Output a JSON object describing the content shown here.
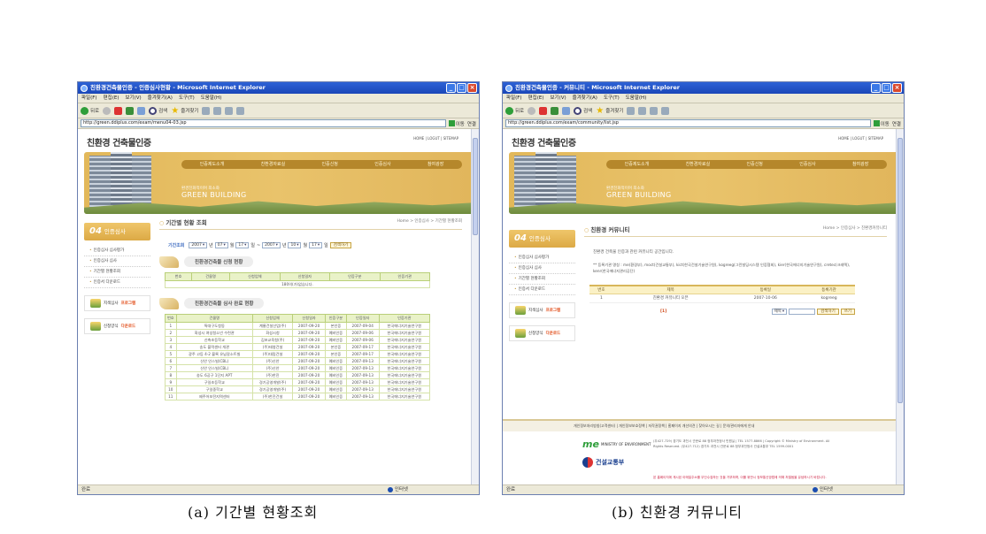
{
  "shotA": {
    "window_title": "친환경건축물인증 - 인증심사현황 - Microsoft Internet Explorer",
    "menus": [
      "파일(F)",
      "편집(E)",
      "보기(V)",
      "즐겨찾기(A)",
      "도구(T)",
      "도움말(H)"
    ],
    "toolbar": {
      "back": "뒤로",
      "search": "검색",
      "favorites": "즐겨찾기"
    },
    "address": "http://green.ddiplus.com/exam/menu04-03.jsp",
    "go_label": "이동",
    "links_label": "연결",
    "site_logo": "친환경 건축물인증",
    "topnav": "HOME | LOGUT | SITEMAP",
    "nav_items": [
      "인증제도소개",
      "친환경자료실",
      "인증신청",
      "인증심사",
      "참여광장"
    ],
    "slogan_small": "환경친화적이며 최소화",
    "slogan_big": "GREEN BUILDING",
    "side_title_num": "04",
    "side_title": "인증심사",
    "side_menu": [
      "인증심사 심사평가",
      "인증심사 심사",
      "기간별 현황조회",
      "인증서 다운로드"
    ],
    "banner1_pre": "지색심사",
    "banner1_red": "프로그램",
    "banner2_pre": "신청양식",
    "banner2_red": "다운로드",
    "page_title": "기간별 현황 조회",
    "breadcrumb": "Home > 인증심사 > 기간별 현황조회",
    "search": {
      "label": "기간조회",
      "y1": "2007",
      "m1": "07",
      "d1": "17",
      "y2": "2007",
      "m2": "10",
      "d2": "17",
      "u_year": "년",
      "u_month": "월",
      "u_day": "일",
      "tilde": "~",
      "button": "검색하기"
    },
    "section1": "친환경건축물 신청 현황",
    "table1_headers": [
      "번호",
      "건물명",
      "신청업체",
      "신청일자",
      "인증구분",
      "인증기관"
    ],
    "table1_empty": "180의(가)없습니다.",
    "section2": "친환경건축물 심사 완료 현황",
    "table2_headers": [
      "번호",
      "건물명",
      "신청업체",
      "신청일자",
      "인증구분",
      "인증일자",
      "인증기관"
    ],
    "table2_rows": [
      [
        "1",
        "특대구도청동",
        "계룡건설산업(주)",
        "2007-09-20",
        "본인증",
        "2007-09-04",
        "한국에너지기술연구원"
      ],
      [
        "2",
        "화성시 여성청소년 수련관",
        "화성시청",
        "2007-09-20",
        "예비인증",
        "2007-09-06",
        "한국에너지기술연구원"
      ],
      [
        "3",
        "신축초등학교",
        "김포교육청(주)",
        "2007-09-20",
        "예비인증",
        "2007-09-06",
        "한국에너지기술연구원"
      ],
      [
        "4",
        "송도 블럭센터 개관",
        "(주)태영건설",
        "2007-09-20",
        "본인증",
        "2007-09-17",
        "한국에너지기술연구원"
      ],
      [
        "5",
        "광주 고등 4-2 블록 유남갈소트빌",
        "(주)대림건설",
        "2007-09-20",
        "본인증",
        "2007-09-17",
        "한국에너지기술연구원"
      ],
      [
        "6",
        "신안 인스빌(CBL)",
        "(주)신안",
        "2007-09-20",
        "예비인증",
        "2007-09-13",
        "한국에너지기술연구원"
      ],
      [
        "7",
        "신안 인스빌(CBL)",
        "(주)신안",
        "2007-09-20",
        "예비인증",
        "2007-09-13",
        "한국에너지기술연구원"
      ],
      [
        "8",
        "송도 6공구 1단지 APT",
        "(주)한진",
        "2007-09-20",
        "예비인증",
        "2007-09-13",
        "한국에너지기술연구원"
      ],
      [
        "9",
        "구일초등학교",
        "경기공영개발(주)",
        "2007-09-20",
        "예비인증",
        "2007-09-13",
        "한국에너지기술연구원"
      ],
      [
        "10",
        "구일중학교",
        "경기공영개발(주)",
        "2007-09-20",
        "예비인증",
        "2007-09-13",
        "한국에너지기술연구원"
      ],
      [
        "11",
        "제주어보전지역센터",
        "(주)한진건설",
        "2007-09-20",
        "예비인증",
        "2007-09-13",
        "한국에너지기술연구원"
      ]
    ],
    "status": "완료",
    "zone": "인터넷"
  },
  "shotB": {
    "window_title": "친환경건축물인증 - 커뮤니티 - Microsoft Internet Explorer",
    "menus": [
      "파일(F)",
      "편집(E)",
      "보기(V)",
      "즐겨찾기(A)",
      "도구(T)",
      "도움말(H)"
    ],
    "toolbar": {
      "back": "뒤로",
      "search": "검색",
      "favorites": "즐겨찾기"
    },
    "address": "http://green.ddiplus.com/exam/community/list.jsp",
    "go_label": "이동",
    "links_label": "연결",
    "site_logo": "친환경 건축물인증",
    "topnav": "HOME | LOGUT | SITEMAP",
    "nav_items": [
      "인증제도소개",
      "친환경자료실",
      "인증신청",
      "인증심사",
      "참여광장"
    ],
    "slogan_small": "환경친화적이며 최소화",
    "slogan_big": "GREEN BUILDING",
    "side_title_num": "04",
    "side_title": "인증심사",
    "side_menu": [
      "인증심사 심사평가",
      "인증심사 심사",
      "기간별 현황조회",
      "인증서 다운로드"
    ],
    "banner1_pre": "지색심사",
    "banner1_red": "프로그램",
    "banner2_pre": "신청양식",
    "banner2_red": "다운로드",
    "page_title": "친환경 커뮤니티",
    "breadcrumb": "Home > 인증심사 > 친환경커뮤니티",
    "intro": "친환경 건축물 인증과 관련 커뮤니티 공간입니다.",
    "intro2": "** 등록기관 명칭 : me(환경부), moct(건설교통부), kict(한국건설기술연구원), kogreeg(그린빌딩시스템 인증협회), kier(한국에너지기술연구원), cretec(크레텍), kenr(한국에너지관리공단)",
    "board_headers": [
      "번호",
      "제목",
      "등록일",
      "등록기관"
    ],
    "board_rows": [
      [
        "1",
        "친환경 커뮤니티 오픈",
        "2007-10-06",
        "kogreeg"
      ]
    ],
    "page_num": "[1]",
    "select_val": "제목",
    "search_btn": "검색하기",
    "write_btn": "쓰기",
    "footer_links": "개인정보처리방침(고객센터) | 개인정보보호정책 | 저작권정책 | 홈페이지 개선의견 | 찾아오시는 길 | 문의/관리자에게 안내",
    "me_mark": "me",
    "me_text": "MINISTRY OF ENVIRONMENT",
    "moct_text": "건설교통부",
    "addr": "(우427-729) 경기도 과천시 관문로 88 정부과천청사 민원실 | TEL 1577-8866 | Copyright © Ministry of Environment. All Rights Reserved. (우427-712) 경기도 과천시 관문로 88 정부과천청사 건설교통부 TEL 1599-0001",
    "note": "본 홈페이지에 게시된 이메일주소를 무단수집하는 것을 거부하며, 이를 위반시 정보통신망법에 의해 처벌됨을 유념하시기 바랍니다.",
    "status": "완료",
    "zone": "인터넷"
  },
  "captions": {
    "a": "(a) 기간별 현황조회",
    "b": "(b) 친환경 커뮤니티"
  }
}
